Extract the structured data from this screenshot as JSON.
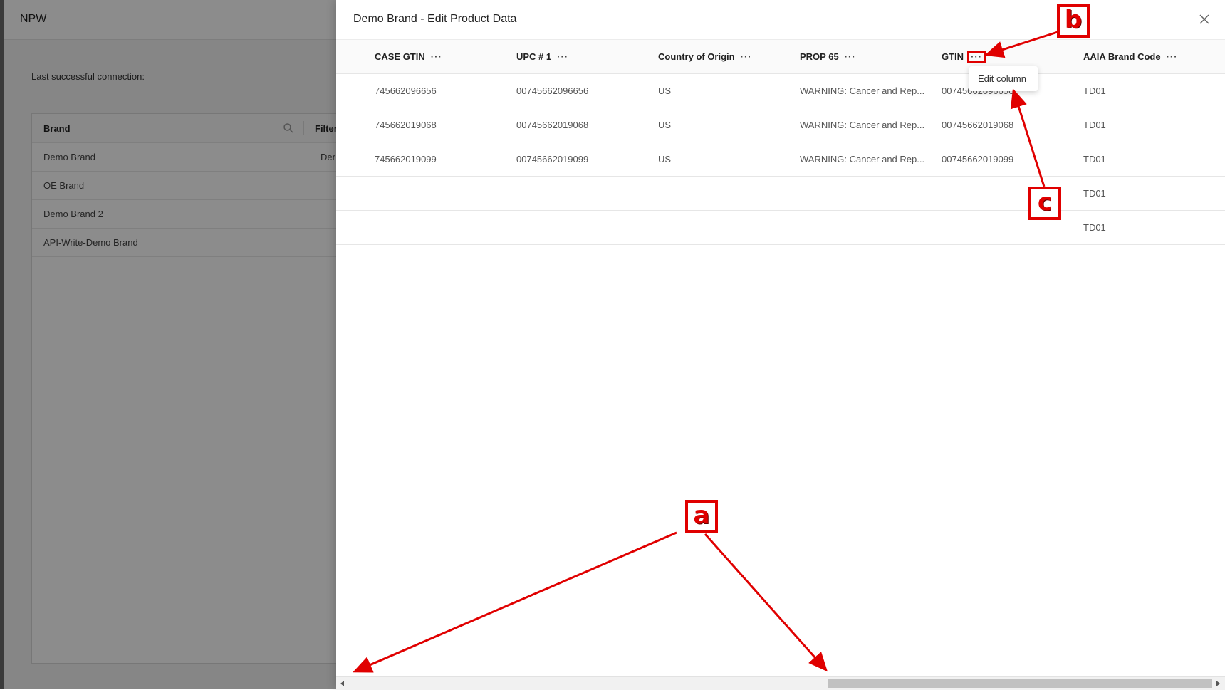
{
  "app": {
    "title": "NPW",
    "connection_label": "Last successful connection:",
    "brand_table": {
      "headers": {
        "brand": "Brand",
        "filter": "Filter"
      },
      "rows": [
        {
          "brand": "Demo Brand",
          "filter": "Der"
        },
        {
          "brand": "OE Brand",
          "filter": ""
        },
        {
          "brand": "Demo Brand 2",
          "filter": ""
        },
        {
          "brand": "API-Write-Demo Brand",
          "filter": ""
        }
      ]
    }
  },
  "drawer": {
    "title": "Demo Brand - Edit Product Data",
    "close_icon": "close-icon",
    "columns": [
      "CASE GTIN",
      "UPC # 1",
      "Country of Origin",
      "PROP 65",
      "GTIN",
      "AAIA Brand Code"
    ],
    "column_menu_icon": "ellipsis-icon",
    "rows": [
      [
        "745662096656",
        "00745662096656",
        "US",
        "WARNING: Cancer and Rep...",
        "00745662096656",
        "TD01"
      ],
      [
        "745662019068",
        "00745662019068",
        "US",
        "WARNING: Cancer and Rep...",
        "00745662019068",
        "TD01"
      ],
      [
        "745662019099",
        "00745662019099",
        "US",
        "WARNING: Cancer and Rep...",
        "00745662019099",
        "TD01"
      ],
      [
        "",
        "",
        "",
        "",
        "",
        "TD01"
      ],
      [
        "",
        "",
        "",
        "",
        "",
        "TD01"
      ]
    ],
    "column_menu": {
      "item": "Edit column"
    }
  },
  "annotations": {
    "a": "a",
    "b": "b",
    "c": "c",
    "color": "#e00000"
  }
}
